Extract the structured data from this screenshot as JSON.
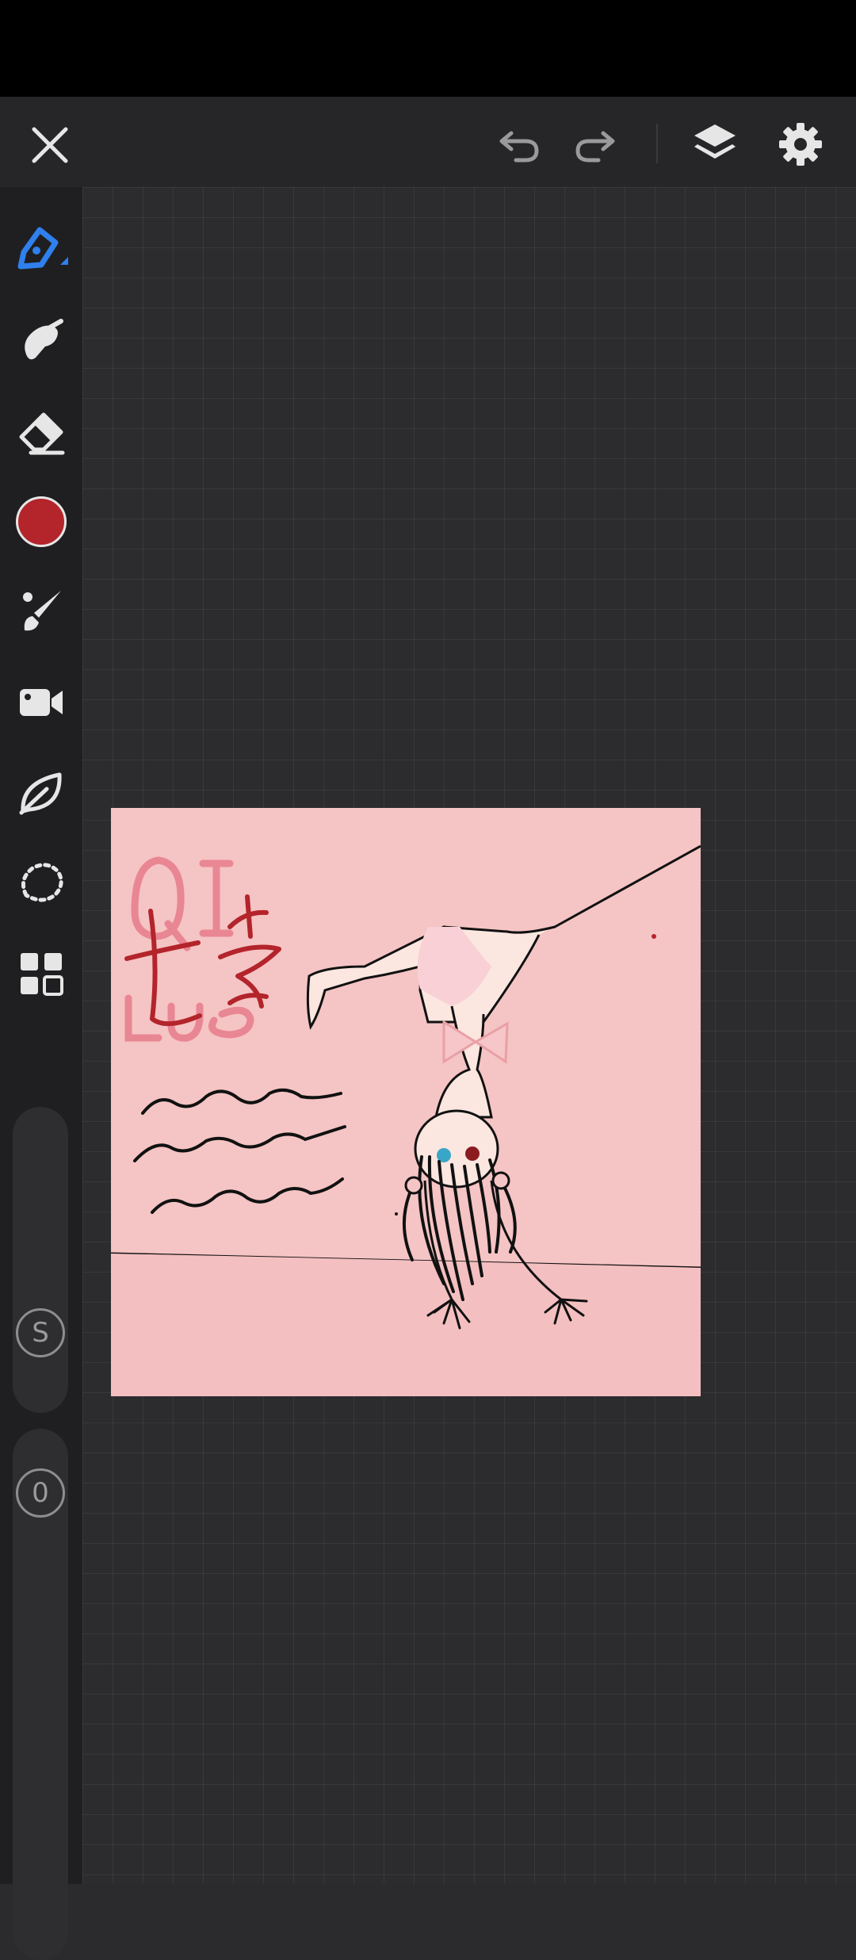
{
  "toolbar": {
    "close_icon": "close-icon",
    "undo_icon": "undo-icon",
    "redo_icon": "redo-icon",
    "layers_icon": "layers-icon",
    "settings_icon": "gear-icon"
  },
  "tools": [
    {
      "name": "pen",
      "icon": "pen-icon",
      "active": true
    },
    {
      "name": "smudge",
      "icon": "smudge-icon"
    },
    {
      "name": "eraser",
      "icon": "eraser-icon"
    },
    {
      "name": "color",
      "icon": "color-swatch",
      "color": "#b3242b"
    },
    {
      "name": "brush-settings",
      "icon": "brush-icon"
    },
    {
      "name": "record",
      "icon": "video-camera-icon"
    },
    {
      "name": "shape",
      "icon": "leaf-icon"
    },
    {
      "name": "selection",
      "icon": "lasso-icon"
    },
    {
      "name": "gallery",
      "icon": "grid-icon"
    }
  ],
  "size_slider": {
    "label": "S"
  },
  "opacity_slider": {
    "label": "0"
  },
  "colors": {
    "accent": "#2f80ed",
    "selected_color": "#b3242b",
    "artboard_bg": "#f5c4c4"
  }
}
